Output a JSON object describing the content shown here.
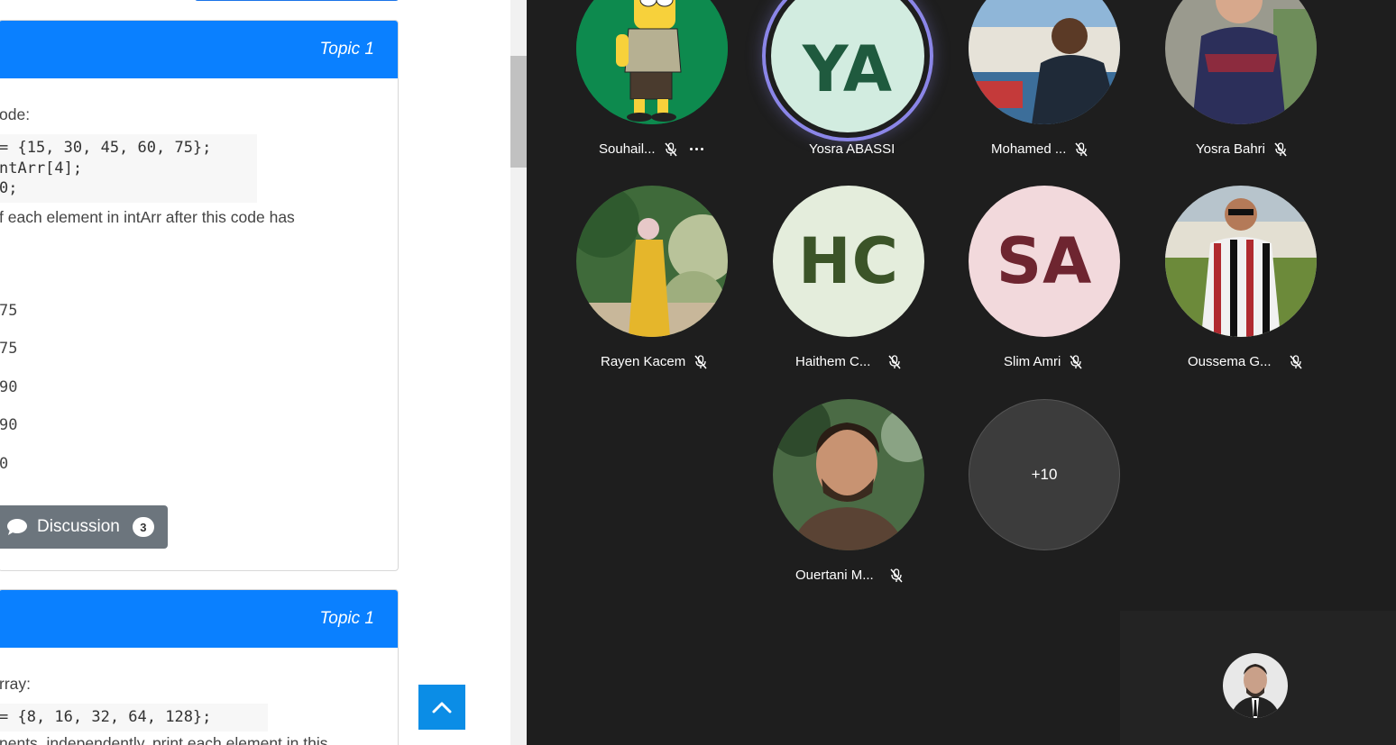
{
  "quiz": {
    "question1": {
      "topic": "Topic 1",
      "intro": "ode:",
      "code": [
        "= {15, 30, 45, 60, 75};",
        "ntArr[4];",
        "0;"
      ],
      "prompt": "f each element in intArr after this code has",
      "options": [
        "75",
        "75",
        "90",
        "90",
        "0"
      ],
      "discussion_label": "Discussion",
      "discussion_count": "3"
    },
    "question2": {
      "topic": "Topic 1",
      "intro": "rray:",
      "code": [
        "= {8, 16, 32, 64, 128};"
      ],
      "prompt": "nents, independently, print each element in this"
    }
  },
  "meeting": {
    "participants": [
      {
        "name": "Souhail...",
        "avatar": "cartoon-character-photo",
        "bg": "#0d8a4e",
        "mic": "muted",
        "more": true
      },
      {
        "name": "Yosra ABASSI",
        "initials": "YA",
        "bg": "#d2ece0",
        "fg": "#1f5a3e",
        "mic": "active-speaker"
      },
      {
        "name": "Mohamed ...",
        "avatar": "man-harbor-photo",
        "mic": "muted"
      },
      {
        "name": "Yosra Bahri",
        "avatar": "woman-scarf-photo",
        "mic": "muted"
      },
      {
        "name": "Rayen Kacem",
        "avatar": "woman-yellow-dress-garden-photo",
        "mic": "muted"
      },
      {
        "name": "Haithem C...",
        "initials": "HC",
        "bg": "#e4eddc",
        "fg": "#3b5428",
        "mic": "muted"
      },
      {
        "name": "Slim Amri",
        "initials": "SA",
        "bg": "#f2d9dc",
        "fg": "#6e2530",
        "mic": "muted"
      },
      {
        "name": "Oussema G...",
        "avatar": "man-sunglasses-field-photo",
        "mic": "muted"
      },
      {
        "name": "Ouertani M...",
        "avatar": "man-beard-portrait-photo",
        "mic": "muted"
      }
    ],
    "overflow_count": "+10",
    "self_view": {
      "avatar": "man-suit-photo"
    }
  },
  "colors": {
    "topic_header": "#0a80ff",
    "discussion_button": "#6c757d",
    "scroll_top_button": "#0b8de6",
    "meeting_bg": "#1e1e1e",
    "speaker_ring": "#8b86e8"
  },
  "icons": [
    "speech-bubble-icon",
    "chevron-up-icon",
    "mic-off-icon",
    "more-options-icon"
  ]
}
